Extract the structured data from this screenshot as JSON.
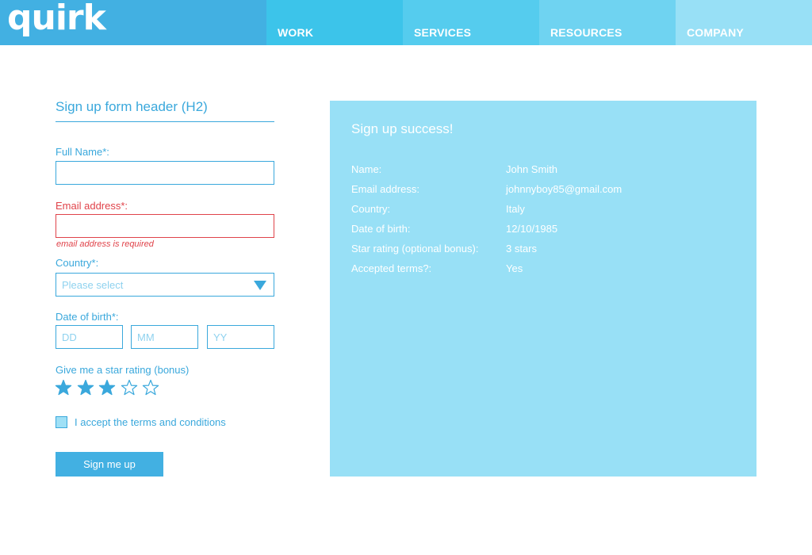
{
  "header": {
    "logo": "quirk",
    "nav": [
      "WORK",
      "SERVICES",
      "RESOURCES",
      "COMPANY"
    ]
  },
  "form": {
    "title": "Sign up form header (H2)",
    "full_name_label": "Full Name*:",
    "full_name_value": "",
    "email_label": "Email address*:",
    "email_value": "",
    "email_error": "email address is required",
    "country_label": "Country*:",
    "country_placeholder": "Please select",
    "dob_label": "Date of birth*:",
    "dob_day_placeholder": "DD",
    "dob_month_placeholder": "MM",
    "dob_year_placeholder": "YY",
    "rating_label": "Give me a star rating (bonus)",
    "rating_value": 3,
    "rating_max": 5,
    "terms_label": "I accept the terms and conditions",
    "submit_label": "Sign me up"
  },
  "success": {
    "title": "Sign up success!",
    "rows": [
      {
        "key": "Name:",
        "value": "John Smith"
      },
      {
        "key": "Email address:",
        "value": "johnnyboy85@gmail.com"
      },
      {
        "key": "Country:",
        "value": "Italy"
      },
      {
        "key": "Date of birth:",
        "value": "12/10/1985"
      },
      {
        "key": "Star rating (optional bonus):",
        "value": "3 stars"
      },
      {
        "key": "Accepted terms?:",
        "value": "Yes"
      }
    ]
  },
  "colors": {
    "primary": "#3aa8dc",
    "error": "#e0434a",
    "panel": "#98e0f6"
  }
}
